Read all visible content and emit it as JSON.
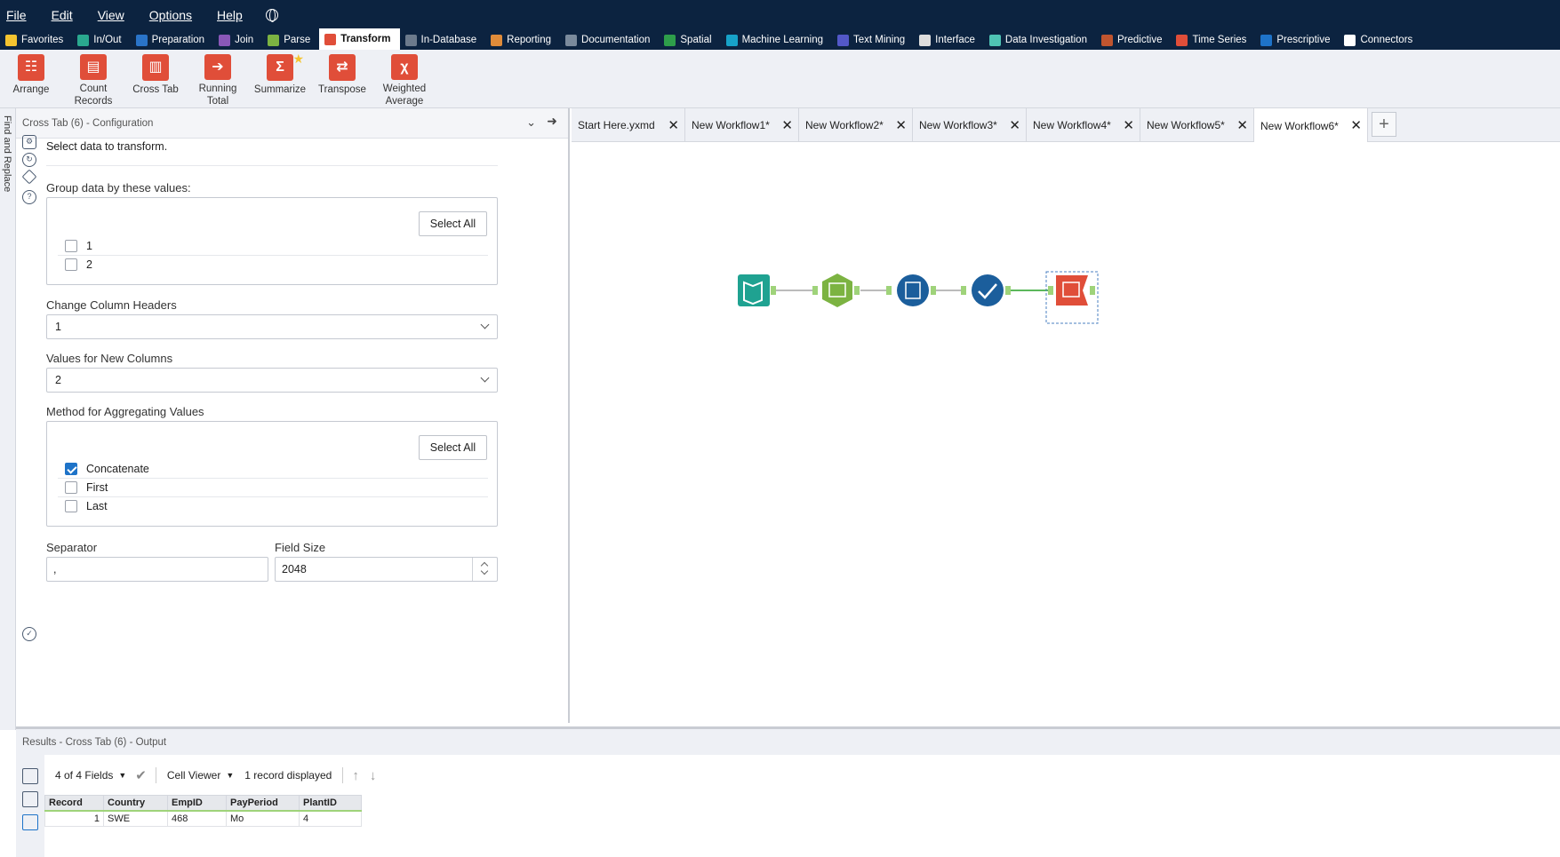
{
  "menu": [
    "File",
    "Edit",
    "View",
    "Options",
    "Help"
  ],
  "categories": [
    {
      "label": "Favorites",
      "color": "#f4c430"
    },
    {
      "label": "In/Out",
      "color": "#2aa88f"
    },
    {
      "label": "Preparation",
      "color": "#2a74c8"
    },
    {
      "label": "Join",
      "color": "#8a58b8"
    },
    {
      "label": "Parse",
      "color": "#7cb342"
    },
    {
      "label": "Transform",
      "color": "#e04e39"
    },
    {
      "label": "In-Database",
      "color": "#6c7a8c"
    },
    {
      "label": "Reporting",
      "color": "#e08c3a"
    },
    {
      "label": "Documentation",
      "color": "#7a8a9c"
    },
    {
      "label": "Spatial",
      "color": "#2e9e4a"
    },
    {
      "label": "Machine Learning",
      "color": "#17a2c8"
    },
    {
      "label": "Text Mining",
      "color": "#5358c8"
    },
    {
      "label": "Interface",
      "color": "#dddddd"
    },
    {
      "label": "Data Investigation",
      "color": "#4fc3b4"
    },
    {
      "label": "Predictive",
      "color": "#c0552f"
    },
    {
      "label": "Time Series",
      "color": "#e04e39"
    },
    {
      "label": "Prescriptive",
      "color": "#1e73c8"
    },
    {
      "label": "Connectors",
      "color": "#ffffff"
    }
  ],
  "tools": [
    {
      "label": "Arrange",
      "icon": "arrange-icon"
    },
    {
      "label": "Count\nRecords",
      "icon": "count-records-icon"
    },
    {
      "label": "Cross Tab",
      "icon": "cross-tab-icon"
    },
    {
      "label": "Running\nTotal",
      "icon": "running-total-icon"
    },
    {
      "label": "Summarize",
      "icon": "summarize-icon"
    },
    {
      "label": "Transpose",
      "icon": "transpose-icon"
    },
    {
      "label": "Weighted\nAverage",
      "icon": "weighted-average-icon"
    }
  ],
  "rail_text": "Find and Replace",
  "config": {
    "header": "Cross Tab (6) - Configuration",
    "intro": "Select data to transform.",
    "group_label": "Group data by these values:",
    "select_all": "Select All",
    "group_fields": [
      "1",
      "2"
    ],
    "headers_label": "Change Column Headers",
    "headers_value": "1",
    "values_label": "Values for New Columns",
    "values_value": "2",
    "method_label": "Method for Aggregating Values",
    "methods": [
      "Concatenate",
      "First",
      "Last"
    ],
    "separator_label": "Separator",
    "separator_value": ",",
    "fieldsize_label": "Field Size",
    "fieldsize_value": "2048"
  },
  "workflow_tabs": [
    "Start Here.yxmd",
    "New Workflow1*",
    "New Workflow2*",
    "New Workflow3*",
    "New Workflow4*",
    "New Workflow5*",
    "New Workflow6*"
  ],
  "results": {
    "header": "Results - Cross Tab (6) - Output",
    "fields": "4 of 4 Fields",
    "viewer": "Cell Viewer",
    "records": "1 record displayed",
    "columns": [
      "Record",
      "Country",
      "EmpID",
      "PayPeriod",
      "PlantID"
    ],
    "rows": [
      [
        "1",
        "SWE",
        "468",
        "Mo",
        "4"
      ]
    ]
  }
}
